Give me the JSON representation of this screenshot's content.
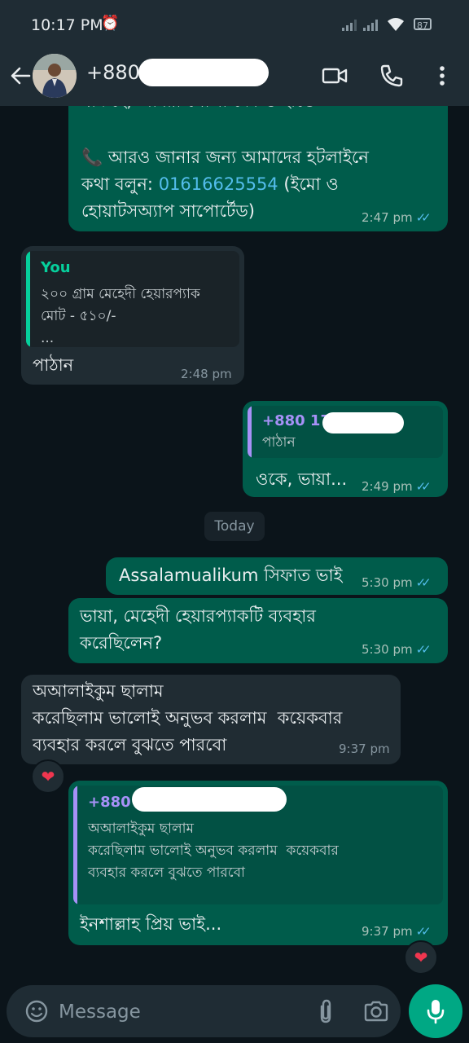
{
  "status_bar": {
    "time": "10:17 PM",
    "battery": "87"
  },
  "header": {
    "contact_name": "+880"
  },
  "messages": {
    "m1": {
      "partial_line": "যদি হে, আমরা খোলা দেম ও হাতে",
      "body": "আরও জানার জন্য আমাদের হটলাইনে\nকথা বলুন:",
      "phone": "01616625554",
      "after_phone": "(ইমো ও\nহোয়াটসঅ্যাপ সাপোর্টেড)",
      "time": "2:47 pm"
    },
    "m2": {
      "quote_name": "You",
      "quote_text": "২০০ গ্রাম মেহেদী হেয়ারপ্যাক\nমোট - ৫১০/-\n...",
      "text": "পাঠান",
      "time": "2:48 pm"
    },
    "m3": {
      "quote_name": "+880 17",
      "quote_text": "পাঠান",
      "text": "ওকে, ভায়া...",
      "time": "2:49 pm"
    },
    "date_divider": "Today",
    "m4": {
      "text": "Assalamualikum সিফাত ভাই",
      "time": "5:30 pm"
    },
    "m5": {
      "text": "ভায়া, মেহেদী হেয়ারপ্যাকটি ব্যবহার\nকরেছিলেন?",
      "time": "5:30 pm"
    },
    "m6": {
      "text": "অআলাইকুম ছালাম\nকরেছিলাম ভালোই অনুভব করলাম  কয়েকবার\nব্যবহার করলে বুঝতে পারবো",
      "time": "9:37 pm",
      "reaction": "❤"
    },
    "m7": {
      "quote_name": "+880",
      "quote_text": "অআলাইকুম ছালাম\nকরেছিলাম ভালোই অনুভব করলাম  কয়েকবার\nব্যবহার করলে বুঝতে পারবো",
      "text": "ইনশাল্লাহ প্রিয় ভাই...",
      "time": "9:37 pm",
      "reaction": "❤"
    }
  },
  "input": {
    "placeholder": "Message"
  },
  "colors": {
    "outgoing_bubble": "#005c4b",
    "incoming_bubble": "#202c33",
    "accent": "#00a884",
    "read_ticks": "#53bdeb"
  }
}
